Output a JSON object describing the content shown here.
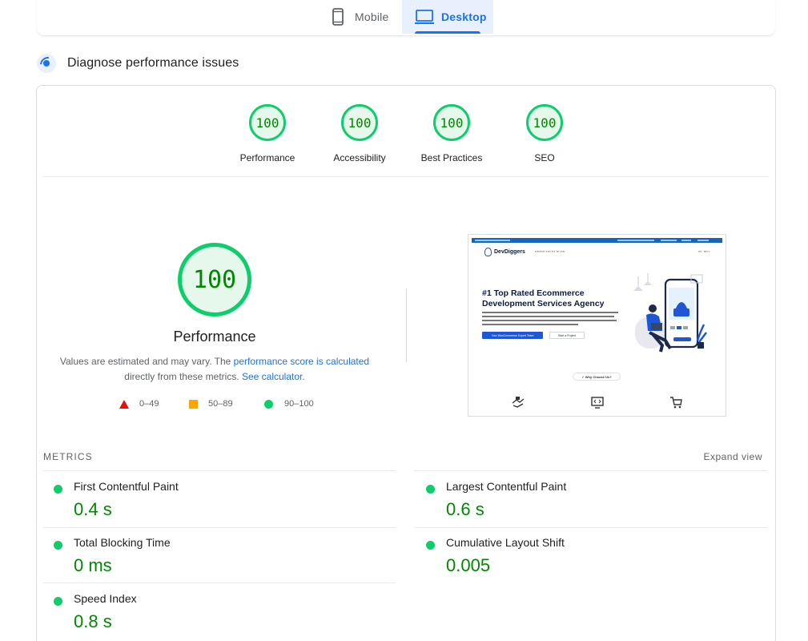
{
  "tabs": [
    {
      "label": "Mobile",
      "icon": "mobile-icon",
      "active": false
    },
    {
      "label": "Desktop",
      "icon": "desktop-icon",
      "active": true
    }
  ],
  "diagnose": {
    "title": "Diagnose performance issues",
    "icon": "lighthouse-icon"
  },
  "categories": [
    {
      "label": "Performance",
      "score": "100"
    },
    {
      "label": "Accessibility",
      "score": "100"
    },
    {
      "label": "Best Practices",
      "score": "100"
    },
    {
      "label": "SEO",
      "score": "100"
    }
  ],
  "performance": {
    "score": "100",
    "label": "Performance",
    "note_prefix": "Values are estimated and may vary. The ",
    "note_link1": "performance score is calculated",
    "note_middle": " directly from these metrics. ",
    "note_link2": "See calculator."
  },
  "legend": [
    {
      "label": "0–49",
      "color": "#eb0f00"
    },
    {
      "label": "50–89",
      "color": "#ffa400"
    },
    {
      "label": "90–100",
      "color": "#0cce6b"
    }
  ],
  "screenshot": {
    "logo": "DevDiggers",
    "headline": "#1 Top Rated Ecommerce Development Services Agency",
    "primary_button": "Your WooCommerce Expert Team",
    "secondary_button": "Start a Project",
    "why": "✓ Why Choose Us?"
  },
  "metrics": {
    "title": "METRICS",
    "expand": "Expand view",
    "items": [
      {
        "name": "First Contentful Paint",
        "value": "0.4 s"
      },
      {
        "name": "Largest Contentful Paint",
        "value": "0.6 s"
      },
      {
        "name": "Total Blocking Time",
        "value": "0 ms"
      },
      {
        "name": "Cumulative Layout Shift",
        "value": "0.005"
      },
      {
        "name": "Speed Index",
        "value": "0.8 s"
      }
    ]
  },
  "colors": {
    "accent": "#1a73e8",
    "pass": "#0cce6b",
    "pass_text": "#008800"
  }
}
